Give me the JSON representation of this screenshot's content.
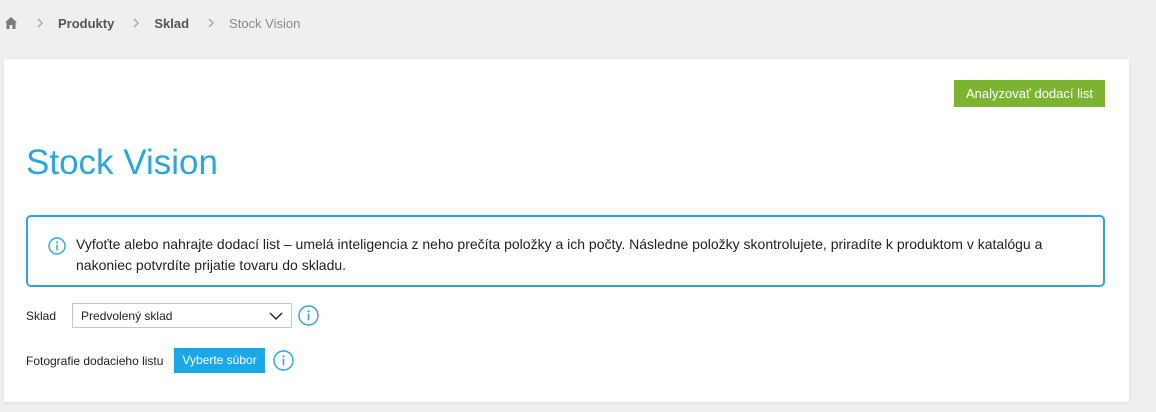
{
  "breadcrumb": {
    "home_icon": "home-icon",
    "items": [
      {
        "label": "Produkty"
      },
      {
        "label": "Sklad"
      }
    ],
    "current": "Stock Vision"
  },
  "toolbar": {
    "analyze_label": "Analyzovať dodací list"
  },
  "page": {
    "title": "Stock Vision"
  },
  "info": {
    "icon": "info-icon",
    "text": "Vyfoťte alebo nahrajte dodací list – umelá inteligencia z neho prečíta položky a ich počty. Následne položky skontrolujete, priradíte k produktom v katalógu a nakoniec potvrdíte prijatie tovaru do skladu."
  },
  "form": {
    "sklad": {
      "label": "Sklad",
      "selected": "Predvolený sklad"
    },
    "photo": {
      "label": "Fotografie dodacieho listu",
      "button_label": "Vyberte súbor"
    }
  },
  "colors": {
    "accent": "#2ba6e0",
    "primary_button": "#7cb331",
    "file_button": "#1ba8e8",
    "background": "#efefef"
  }
}
